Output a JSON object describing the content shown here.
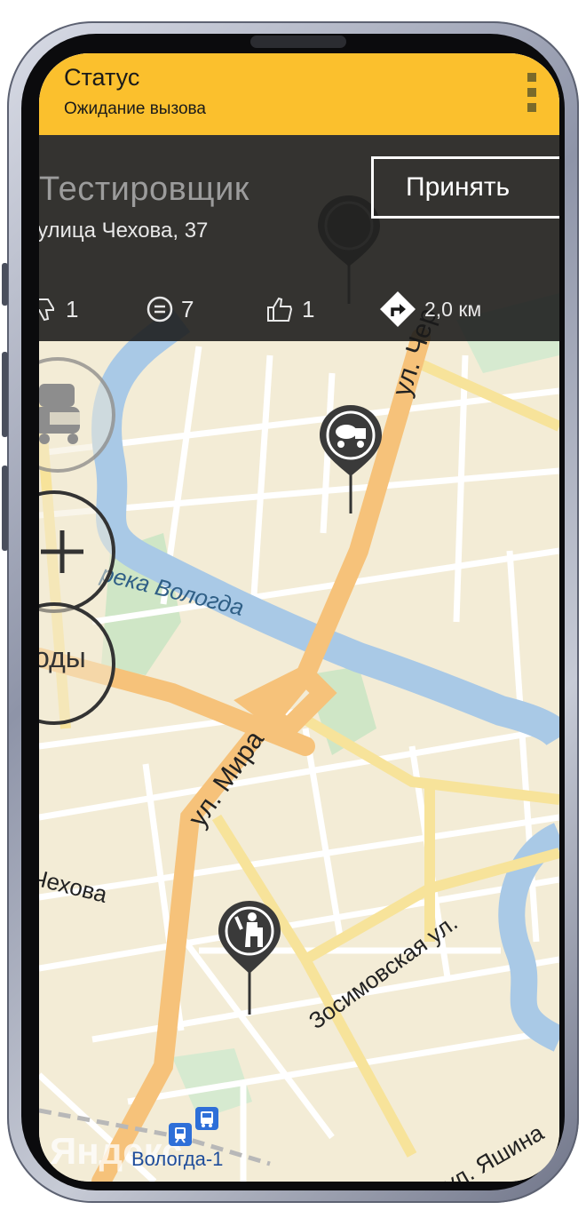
{
  "status": {
    "title": "Статус",
    "subtitle": "Ожидание вызова"
  },
  "order": {
    "client_name": "Тестировщик",
    "address": "улица Чехова, 37",
    "accept_label": "Принять",
    "dislikes": "1",
    "reviews": "7",
    "likes": "1",
    "distance": "2,0 км"
  },
  "map": {
    "labels": {
      "street_cher": "ул. Чер",
      "river": "река Вологда",
      "street_mira": "ул. Мира",
      "street_chekhova": "Чехова",
      "street_zosimovskaya": "Зосимовская ул.",
      "street_yashina": "ул. Яшина",
      "station": "Вологда-1",
      "zoom_out_fragment": "оды",
      "watermark": "Яндекс"
    }
  },
  "icons": {
    "menu": "overflow-menu-icon",
    "dislike": "thumbs-down-icon",
    "reviews": "comment-equals-icon",
    "like": "thumbs-up-icon",
    "distance": "turn-right-direction-icon",
    "traffic": "traffic-cars-icon",
    "zoom_in": "plus-icon",
    "pin_truck": "concrete-mixer-pin-icon",
    "pin_person": "person-sitting-pin-icon",
    "station": "train-station-icon",
    "bus": "bus-stop-icon"
  },
  "colors": {
    "status_bar": "#fbc02d",
    "panel": "#191919",
    "map_bg": "#f3ecd6",
    "road_main": "#f6c27a",
    "river": "#a9c9e6"
  }
}
